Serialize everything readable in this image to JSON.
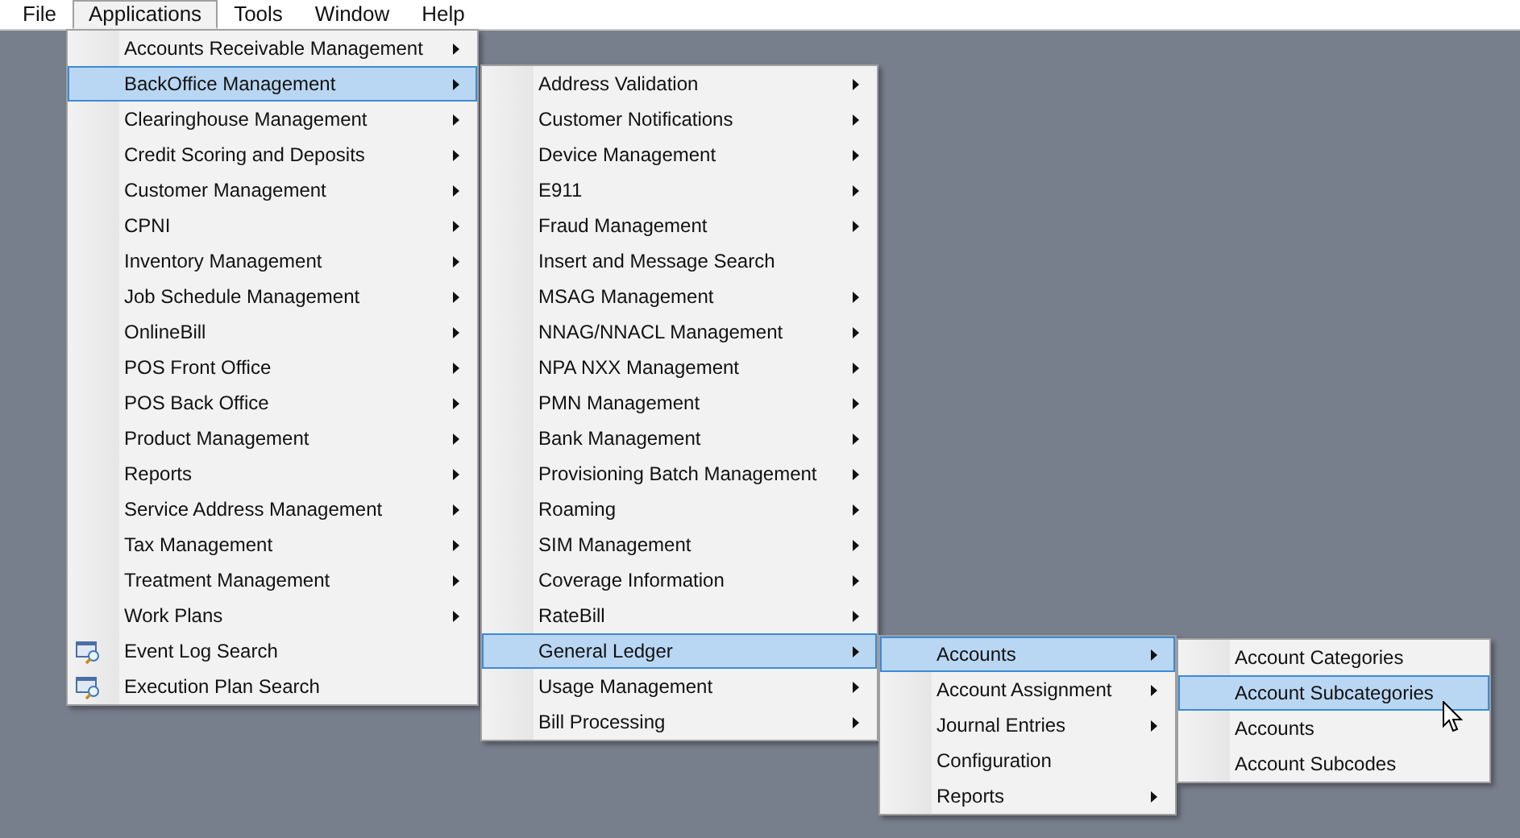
{
  "menubar": [
    {
      "label": "File",
      "selected": false
    },
    {
      "label": "Applications",
      "selected": true
    },
    {
      "label": "Tools",
      "selected": false
    },
    {
      "label": "Window",
      "selected": false
    },
    {
      "label": "Help",
      "selected": false
    }
  ],
  "menus": [
    {
      "items": [
        {
          "label": "Accounts Receivable Management",
          "kind": "plain",
          "submenu": true,
          "selected": false
        },
        {
          "label": "BackOffice Management",
          "kind": "plain",
          "submenu": true,
          "selected": true
        },
        {
          "label": "Clearinghouse Management",
          "kind": "plain",
          "submenu": true,
          "selected": false
        },
        {
          "label": "Credit Scoring and Deposits",
          "kind": "plain",
          "submenu": true,
          "selected": false
        },
        {
          "label": "Customer Management",
          "kind": "plain",
          "submenu": true,
          "selected": false
        },
        {
          "label": "CPNI",
          "kind": "plain",
          "submenu": true,
          "selected": false
        },
        {
          "label": "Inventory Management",
          "kind": "plain",
          "submenu": true,
          "selected": false
        },
        {
          "label": "Job Schedule Management",
          "kind": "plain",
          "submenu": true,
          "selected": false
        },
        {
          "label": "OnlineBill",
          "kind": "plain",
          "submenu": true,
          "selected": false
        },
        {
          "label": "POS Front Office",
          "kind": "plain",
          "submenu": true,
          "selected": false
        },
        {
          "label": "POS Back Office",
          "kind": "plain",
          "submenu": true,
          "selected": false
        },
        {
          "label": "Product Management",
          "kind": "plain",
          "submenu": true,
          "selected": false
        },
        {
          "label": "Reports",
          "kind": "plain",
          "submenu": true,
          "selected": false
        },
        {
          "label": "Service Address Management",
          "kind": "plain",
          "submenu": true,
          "selected": false
        },
        {
          "label": "Tax Management",
          "kind": "plain",
          "submenu": true,
          "selected": false
        },
        {
          "label": "Treatment Management",
          "kind": "plain",
          "submenu": true,
          "selected": false
        },
        {
          "label": "Work Plans",
          "kind": "plain",
          "submenu": true,
          "selected": false
        },
        {
          "label": "Event Log Search",
          "kind": "search",
          "submenu": false,
          "selected": false
        },
        {
          "label": "Execution Plan Search",
          "kind": "search",
          "submenu": false,
          "selected": false
        }
      ]
    },
    {
      "items": [
        {
          "label": "Address Validation",
          "kind": "plain",
          "submenu": true,
          "selected": false
        },
        {
          "label": "Customer Notifications",
          "kind": "plain",
          "submenu": true,
          "selected": false
        },
        {
          "label": "Device Management",
          "kind": "plain",
          "submenu": true,
          "selected": false
        },
        {
          "label": "E911",
          "kind": "plain",
          "submenu": true,
          "selected": false
        },
        {
          "label": "Fraud Management",
          "kind": "plain",
          "submenu": true,
          "selected": false
        },
        {
          "label": "Insert and Message Search",
          "kind": "plain",
          "submenu": false,
          "selected": false
        },
        {
          "label": "MSAG Management",
          "kind": "plain",
          "submenu": true,
          "selected": false
        },
        {
          "label": "NNAG/NNACL Management",
          "kind": "plain",
          "submenu": true,
          "selected": false
        },
        {
          "label": "NPA NXX Management",
          "kind": "plain",
          "submenu": true,
          "selected": false
        },
        {
          "label": "PMN Management",
          "kind": "plain",
          "submenu": true,
          "selected": false
        },
        {
          "label": "Bank Management",
          "kind": "plain",
          "submenu": true,
          "selected": false
        },
        {
          "label": "Provisioning Batch Management",
          "kind": "plain",
          "submenu": true,
          "selected": false
        },
        {
          "label": "Roaming",
          "kind": "plain",
          "submenu": true,
          "selected": false
        },
        {
          "label": "SIM Management",
          "kind": "plain",
          "submenu": true,
          "selected": false
        },
        {
          "label": "Coverage Information",
          "kind": "plain",
          "submenu": true,
          "selected": false
        },
        {
          "label": "RateBill",
          "kind": "plain",
          "submenu": true,
          "selected": false
        },
        {
          "label": "General Ledger",
          "kind": "plain",
          "submenu": true,
          "selected": true
        },
        {
          "label": "Usage Management",
          "kind": "plain",
          "submenu": true,
          "selected": false
        },
        {
          "label": "Bill Processing",
          "kind": "plain",
          "submenu": true,
          "selected": false
        }
      ]
    },
    {
      "items": [
        {
          "label": "Accounts",
          "kind": "plain",
          "submenu": true,
          "selected": true
        },
        {
          "label": "Account Assignment",
          "kind": "plain",
          "submenu": true,
          "selected": false
        },
        {
          "label": "Journal Entries",
          "kind": "plain",
          "submenu": true,
          "selected": false
        },
        {
          "label": "Configuration",
          "kind": "plain",
          "submenu": false,
          "selected": false
        },
        {
          "label": "Reports",
          "kind": "plain",
          "submenu": true,
          "selected": false
        }
      ]
    },
    {
      "items": [
        {
          "label": "Account Categories",
          "kind": "plain",
          "submenu": false,
          "selected": false
        },
        {
          "label": "Account Subcategories",
          "kind": "plain",
          "submenu": false,
          "selected": true
        },
        {
          "label": "Accounts",
          "kind": "plain",
          "submenu": false,
          "selected": false
        },
        {
          "label": "Account Subcodes",
          "kind": "plain",
          "submenu": false,
          "selected": false
        }
      ]
    }
  ]
}
